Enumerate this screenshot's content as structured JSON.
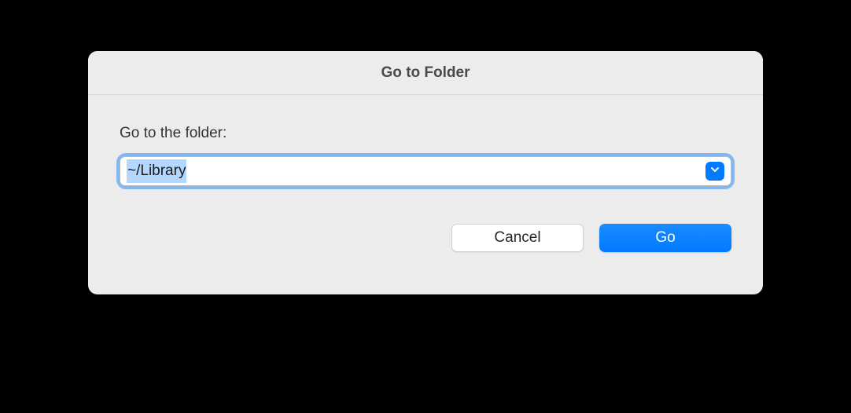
{
  "dialog": {
    "title": "Go to Folder",
    "prompt": "Go to the folder:",
    "path_value": "~/Library",
    "buttons": {
      "cancel": "Cancel",
      "go": "Go"
    }
  }
}
